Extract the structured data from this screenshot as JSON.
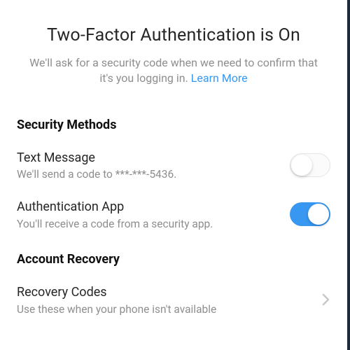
{
  "header": {
    "title": "Two-Factor Authentication is On",
    "subtitle_prefix": "We'll ask for a security code when we need to confirm that it's you logging in. ",
    "learn_more": "Learn More"
  },
  "sections": {
    "security_methods": {
      "heading": "Security Methods",
      "text_message": {
        "title": "Text Message",
        "desc": "We'll send a code to ***-***-5436.",
        "enabled": false
      },
      "auth_app": {
        "title": "Authentication App",
        "desc": "You'll receive a code from a security app.",
        "enabled": true
      }
    },
    "account_recovery": {
      "heading": "Account Recovery",
      "recovery_codes": {
        "title": "Recovery Codes",
        "desc": "Use these when your phone isn't available"
      }
    }
  }
}
